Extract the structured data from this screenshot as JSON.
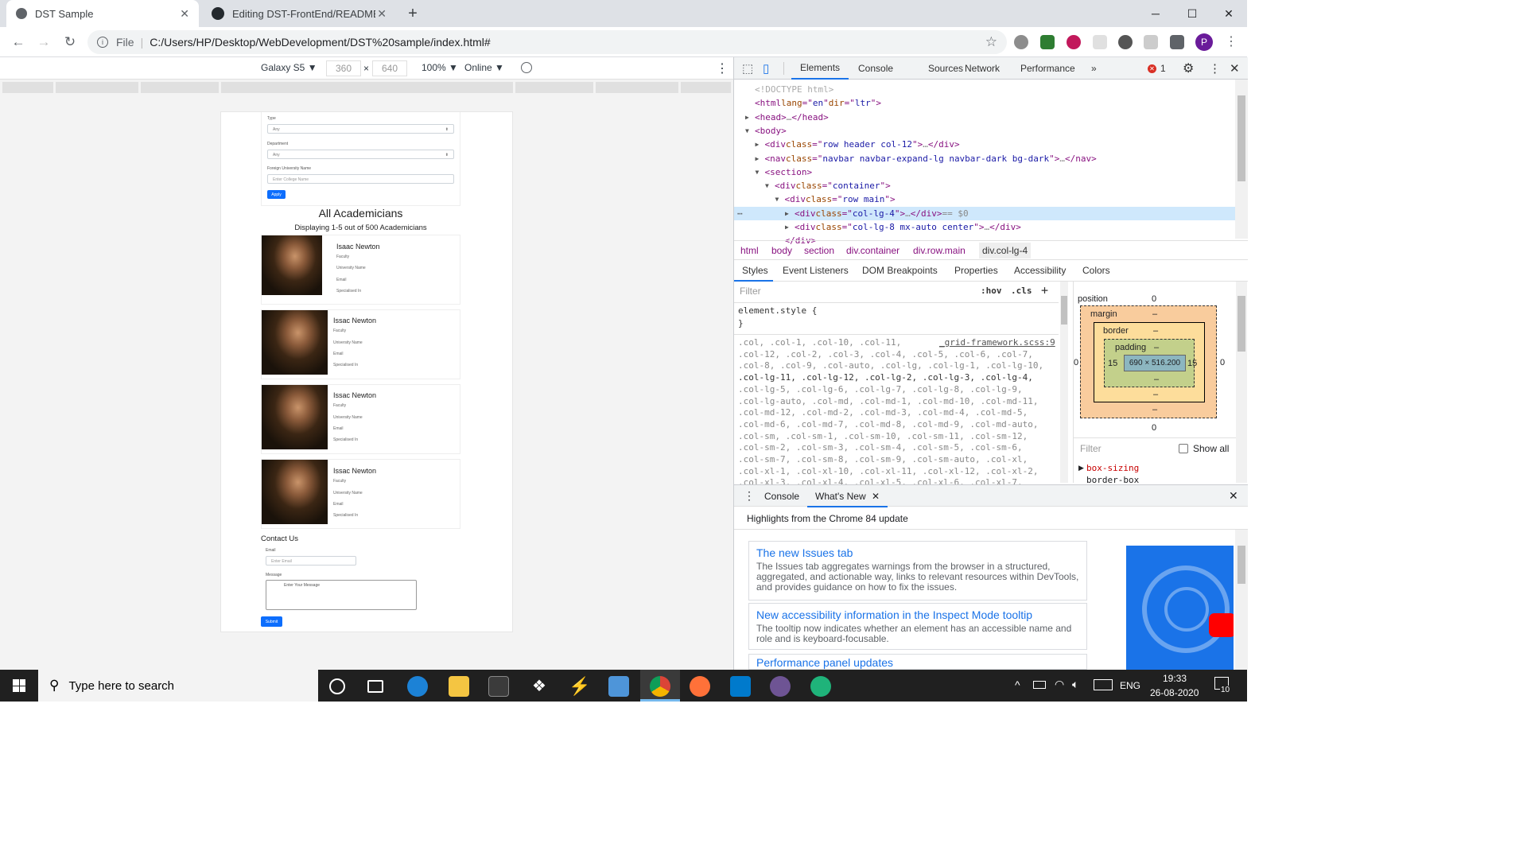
{
  "browser": {
    "tabs": [
      {
        "title": "DST Sample",
        "active": true
      },
      {
        "title": "Editing DST-FrontEnd/README.m",
        "active": false
      }
    ],
    "new_tab": "+",
    "window_buttons": {
      "minimize": "─",
      "maximize": "☐",
      "close": "✕"
    },
    "address": {
      "scheme_label": "File",
      "separator": "|",
      "url": "C:/Users/HP/Desktop/WebDevelopment/DST%20sample/index.html#"
    },
    "profile_initial": "P"
  },
  "device_toolbar": {
    "device": "Galaxy S5 ▼",
    "width": "360",
    "times": "×",
    "height": "640",
    "zoom": "100% ▼",
    "network": "Online ▼"
  },
  "mobile_page": {
    "filters": [
      {
        "label": "Type",
        "value": "Any"
      },
      {
        "label": "Department",
        "value": "Any"
      }
    ],
    "foreign_uni_label": "Foreign University Name",
    "foreign_uni_placeholder": "Enter College Name",
    "apply_label": "Apply",
    "heading": "All Academicians",
    "subheading": "Displaying 1-5 out of 500 Academicians",
    "cards": [
      {
        "name": "Isaac Newton",
        "fields": [
          "Faculty",
          "University Name",
          "Email",
          "Specialised In"
        ]
      },
      {
        "name": "Issac Newton",
        "fields": [
          "Faculty",
          "University Name",
          "Email",
          "Specialised In"
        ]
      },
      {
        "name": "Issac Newton",
        "fields": [
          "Faculty",
          "University Name",
          "Email",
          "Specialised In"
        ]
      },
      {
        "name": "Issac Newton",
        "fields": [
          "Faculty",
          "University Name",
          "Email",
          "Specialised In"
        ]
      }
    ],
    "contact": {
      "title": "Contact Us",
      "email_label": "Email",
      "email_placeholder": "Enter Email",
      "message_label": "Message",
      "message_placeholder": "Enter Your Message",
      "submit_label": "Submit"
    }
  },
  "devtools": {
    "tabs": [
      "Elements",
      "Console",
      "Sources",
      "Network",
      "Performance",
      "»"
    ],
    "active_tab": "Elements",
    "error_count": "1",
    "dom_lines": [
      {
        "indent": 0,
        "arrow": "",
        "parts": [
          [
            "cm",
            "<!DOCTYPE html>"
          ]
        ]
      },
      {
        "indent": 0,
        "arrow": "",
        "parts": [
          [
            "tag",
            "<html "
          ],
          [
            "attr",
            "lang"
          ],
          [
            "tag",
            "=\""
          ],
          [
            "val",
            "en"
          ],
          [
            "tag",
            "\" "
          ],
          [
            "attr",
            "dir"
          ],
          [
            "tag",
            "=\""
          ],
          [
            "val",
            "ltr"
          ],
          [
            "tag",
            "\">"
          ]
        ]
      },
      {
        "indent": 0,
        "arrow": "▶",
        "parts": [
          [
            "tag",
            "<head>"
          ],
          [
            "muted",
            "…"
          ],
          [
            "tag",
            "</head>"
          ]
        ]
      },
      {
        "indent": 0,
        "arrow": "▼",
        "parts": [
          [
            "tag",
            "<body>"
          ]
        ]
      },
      {
        "indent": 1,
        "arrow": "▶",
        "parts": [
          [
            "tag",
            "<div "
          ],
          [
            "attr",
            "class"
          ],
          [
            "tag",
            "=\""
          ],
          [
            "val",
            "row header col-12"
          ],
          [
            "tag",
            "\">"
          ],
          [
            "muted",
            "…"
          ],
          [
            "tag",
            "</div>"
          ]
        ]
      },
      {
        "indent": 1,
        "arrow": "▶",
        "parts": [
          [
            "tag",
            "<nav "
          ],
          [
            "attr",
            "class"
          ],
          [
            "tag",
            "=\""
          ],
          [
            "val",
            "navbar navbar-expand-lg navbar-dark bg-dark"
          ],
          [
            "tag",
            "\">"
          ],
          [
            "muted",
            "…"
          ],
          [
            "tag",
            "</nav>"
          ]
        ]
      },
      {
        "indent": 1,
        "arrow": "▼",
        "parts": [
          [
            "tag",
            "<section>"
          ]
        ]
      },
      {
        "indent": 2,
        "arrow": "▼",
        "parts": [
          [
            "tag",
            "<div "
          ],
          [
            "attr",
            "class"
          ],
          [
            "tag",
            "=\""
          ],
          [
            "val",
            "container"
          ],
          [
            "tag",
            "\">"
          ]
        ]
      },
      {
        "indent": 3,
        "arrow": "▼",
        "parts": [
          [
            "tag",
            "<div "
          ],
          [
            "attr",
            "class"
          ],
          [
            "tag",
            "=\""
          ],
          [
            "val",
            "row main"
          ],
          [
            "tag",
            "\">"
          ]
        ]
      },
      {
        "indent": 4,
        "arrow": "▶",
        "selected": true,
        "parts": [
          [
            "tag",
            "<div "
          ],
          [
            "attr",
            "class"
          ],
          [
            "tag",
            "=\""
          ],
          [
            "val",
            "col-lg-4"
          ],
          [
            "tag",
            "\">"
          ],
          [
            "muted",
            "…"
          ],
          [
            "tag",
            "</div>"
          ],
          [
            "muted",
            " == $0"
          ]
        ]
      },
      {
        "indent": 4,
        "arrow": "▶",
        "parts": [
          [
            "tag",
            "<div "
          ],
          [
            "attr",
            "class"
          ],
          [
            "tag",
            "=\""
          ],
          [
            "val",
            "col-lg-8 mx-auto center"
          ],
          [
            "tag",
            "\">"
          ],
          [
            "muted",
            "…"
          ],
          [
            "tag",
            "</div>"
          ]
        ]
      },
      {
        "indent": 3,
        "arrow": "",
        "parts": [
          [
            "tag",
            "</div>"
          ]
        ]
      }
    ],
    "breadcrumb": [
      "html",
      "body",
      "section",
      "div.container",
      "div.row.main",
      "div.col-lg-4"
    ],
    "styles_tabs": [
      "Styles",
      "Event Listeners",
      "DOM Breakpoints",
      "Properties",
      "Accessibility",
      "Colors"
    ],
    "filter_placeholder": "Filter",
    "hov": ":hov",
    "cls": ".cls",
    "element_style": "element.style {",
    "element_style_close": "}",
    "rule_source": "_grid-framework.scss:9",
    "selector_lines": [
      ".col, .col-1, .col-10, .col-11,",
      ".col-12, .col-2, .col-3, .col-4, .col-5, .col-6, .col-7,",
      ".col-8, .col-9, .col-auto, .col-lg, .col-lg-1, .col-lg-10,",
      ".col-lg-11, .col-lg-12, .col-lg-2, .col-lg-3, .col-lg-4,",
      ".col-lg-5, .col-lg-6, .col-lg-7, .col-lg-8, .col-lg-9,",
      ".col-lg-auto, .col-md, .col-md-1, .col-md-10, .col-md-11,",
      ".col-md-12, .col-md-2, .col-md-3, .col-md-4, .col-md-5,",
      ".col-md-6, .col-md-7, .col-md-8, .col-md-9, .col-md-auto,",
      ".col-sm, .col-sm-1, .col-sm-10, .col-sm-11, .col-sm-12,",
      ".col-sm-2, .col-sm-3, .col-sm-4, .col-sm-5, .col-sm-6,",
      ".col-sm-7, .col-sm-8, .col-sm-9, .col-sm-auto, .col-xl,",
      ".col-xl-1, .col-xl-10, .col-xl-11, .col-xl-12, .col-xl-2,",
      ".col-xl-3, .col-xl-4, .col-xl-5, .col-xl-6, .col-xl-7,"
    ],
    "box_model": {
      "position_label": "position",
      "position_value": "0",
      "margin_label": "margin",
      "border_label": "border",
      "padding_label": "padding",
      "dash": "–",
      "content": "690 × 516.200",
      "pad_left": "15",
      "pad_right": "15",
      "outer_bottom": "0",
      "outer_left": "0",
      "outer_right": "0"
    },
    "computed_filter": "Filter",
    "show_all": "Show all",
    "computed_prop": "box-sizing",
    "computed_val": "border-box",
    "drawer_tabs": [
      "Console",
      "What's New"
    ],
    "whats_new_heading": "Highlights from the Chrome 84 update",
    "whats_new_cards": [
      {
        "title": "The new Issues tab",
        "desc": "The Issues tab aggregates warnings from the browser in a structured, aggregated, and actionable way, links to relevant resources within DevTools, and provides guidance on how to fix the issues."
      },
      {
        "title": "New accessibility information in the Inspect Mode tooltip",
        "desc": "The tooltip now indicates whether an element has an accessible name and role and is keyboard-focusable."
      },
      {
        "title": "Performance panel updates",
        "desc": ""
      }
    ]
  },
  "taskbar": {
    "search_placeholder": "Type here to search",
    "language": "ENG",
    "time": "19:33",
    "date": "26-08-2020",
    "notification_count": "10"
  },
  "colors": {
    "accent": "#1a73e8",
    "bootstrap_primary": "#0d6efd",
    "selected_row": "#cfe8fc",
    "margin_box": "#f9cc9d",
    "border_box": "#fddd9b",
    "padding_box": "#c3d08b",
    "content_box": "#8cb6c0"
  }
}
